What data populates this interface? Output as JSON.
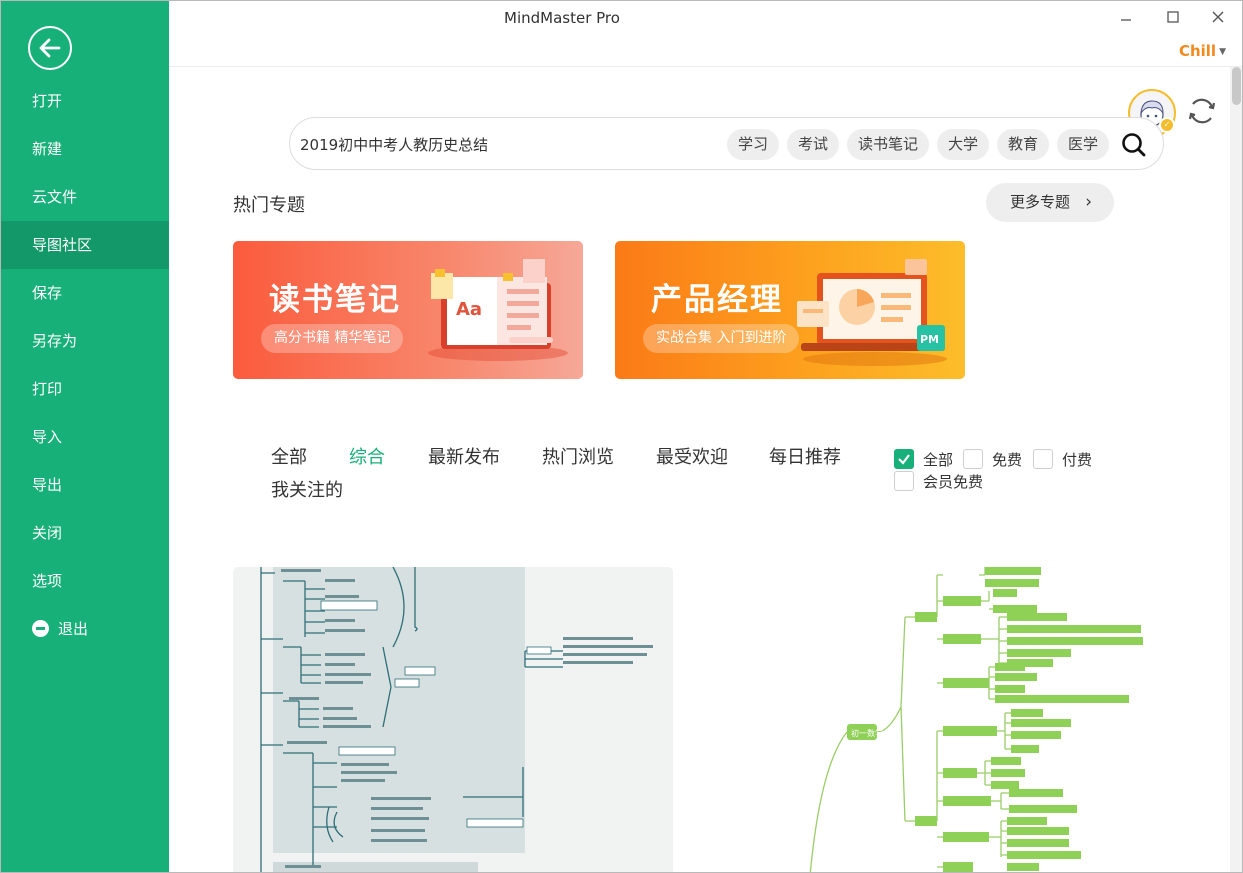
{
  "window": {
    "title": "MindMaster Pro",
    "controls": {
      "minimize": "–",
      "maximize": "☐",
      "close": "✕"
    },
    "user": {
      "name": "Chill"
    }
  },
  "sidebar": {
    "accent": "#17b078",
    "items": [
      {
        "label": "打开"
      },
      {
        "label": "新建"
      },
      {
        "label": "云文件"
      },
      {
        "label": "导图社区",
        "active": true
      },
      {
        "label": "保存"
      },
      {
        "label": "另存为"
      },
      {
        "label": "打印"
      },
      {
        "label": "导入"
      },
      {
        "label": "导出"
      },
      {
        "label": "关闭"
      },
      {
        "label": "选项"
      },
      {
        "label": "退出",
        "icon": "exit-icon"
      }
    ]
  },
  "search": {
    "value": "2019初中中考人教历史总结",
    "chips": [
      "学习",
      "考试",
      "读书笔记",
      "大学",
      "教育",
      "医学"
    ]
  },
  "hot": {
    "title": "热门专题",
    "more": "更多专题",
    "banners": [
      {
        "title": "读书笔记",
        "subtitle": "高分书籍 精华笔记"
      },
      {
        "title": "产品经理",
        "subtitle": "实战合集 入门到进阶"
      }
    ]
  },
  "tabs": {
    "items": [
      "全部",
      "综合",
      "最新发布",
      "热门浏览",
      "最受欢迎",
      "每日推荐",
      "我关注的"
    ],
    "active": "综合"
  },
  "filters": [
    {
      "label": "全部",
      "checked": true
    },
    {
      "label": "免费",
      "checked": false
    },
    {
      "label": "付费",
      "checked": false
    },
    {
      "label": "会员免费",
      "checked": false
    }
  ],
  "cards": {
    "card2_root_label": "初一数学"
  }
}
